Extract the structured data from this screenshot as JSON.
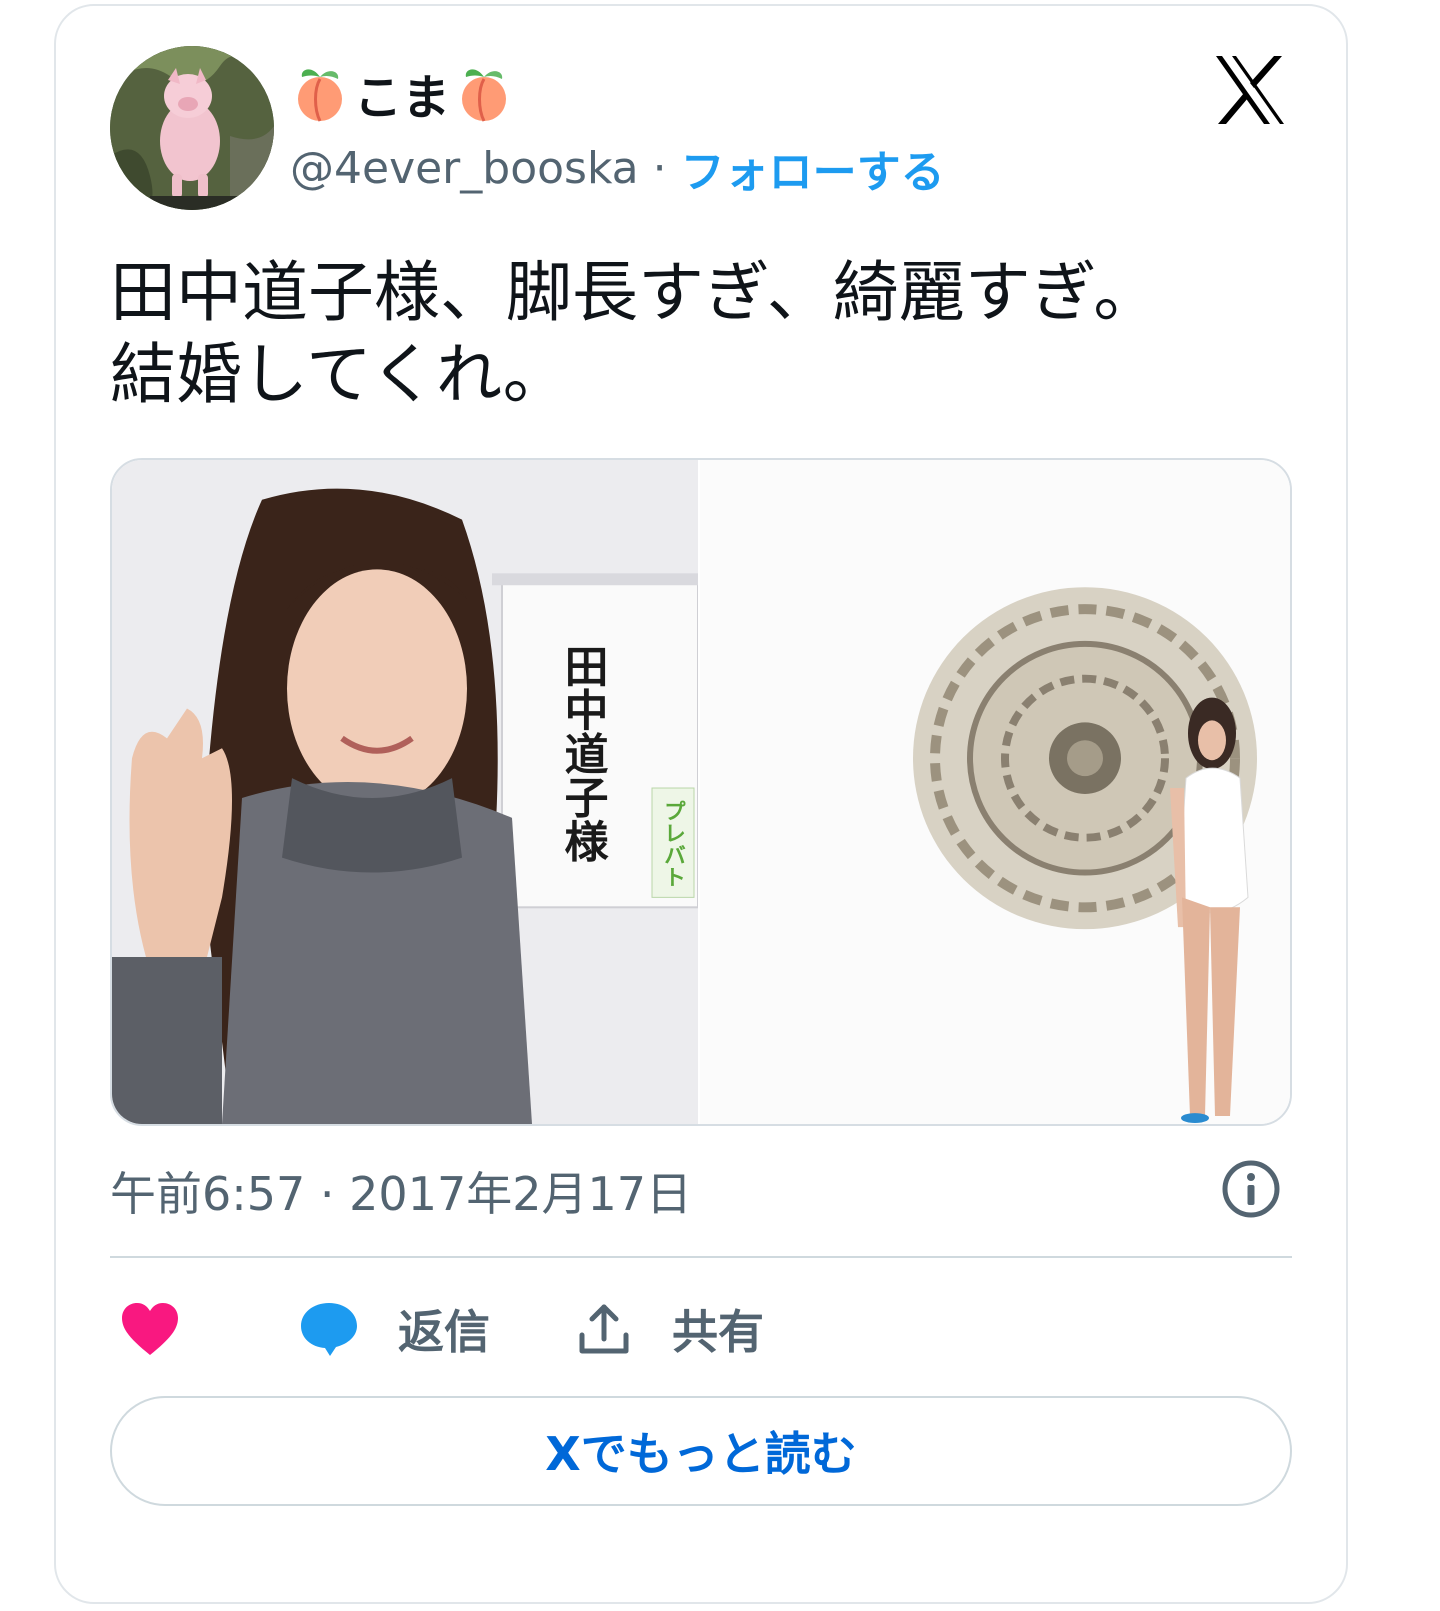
{
  "author": {
    "display_name": "こま",
    "handle": "@4ever_booska",
    "separator": "·",
    "follow_label": "フォローする"
  },
  "tweet": {
    "text_line1": "田中道子様、脚長すぎ、綺麗すぎ。",
    "text_line2": "結婚してくれ。"
  },
  "media": {
    "sign_text": "田中道子様",
    "sign_sticker": "プレバト"
  },
  "timestamp": "午前6:57 · 2017年2月17日",
  "actions": {
    "reply_label": "返信",
    "share_label": "共有"
  },
  "read_more_label": "Xでもっと読む",
  "icons": [
    "peach-icon",
    "x-logo-icon",
    "info-icon",
    "heart-icon",
    "reply-icon",
    "share-icon"
  ],
  "colors": {
    "accent": "#1d9bf0",
    "link": "#0068d8",
    "like": "#f91880",
    "secondary_text": "#536471"
  }
}
